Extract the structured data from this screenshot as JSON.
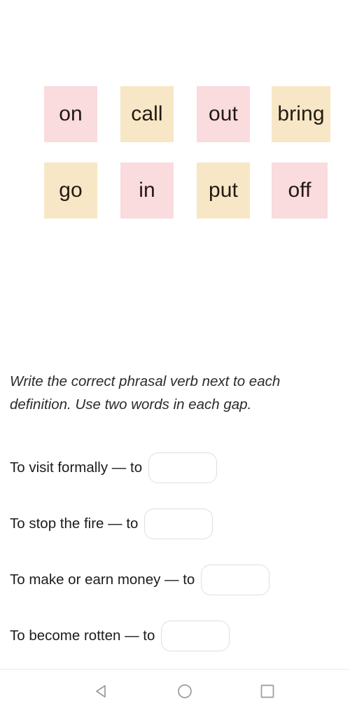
{
  "screen": {
    "background_color": "#ffffff",
    "text_color": "#1c1c1c"
  },
  "word_bank": {
    "tile_colors": {
      "pink": "#fadbde",
      "cream": "#f7e7c6"
    },
    "rows": [
      [
        {
          "label": "on",
          "color": "pink"
        },
        {
          "label": "call",
          "color": "cream"
        },
        {
          "label": "out",
          "color": "pink"
        },
        {
          "label": "bring",
          "color": "cream"
        }
      ],
      [
        {
          "label": "go",
          "color": "cream"
        },
        {
          "label": "in",
          "color": "pink"
        },
        {
          "label": "put",
          "color": "cream"
        },
        {
          "label": "off",
          "color": "pink"
        }
      ]
    ]
  },
  "instruction": {
    "line1": "Write the correct phrasal verb next to each",
    "line2": "definition. Use two words in each gap."
  },
  "questions": [
    {
      "prompt": "To visit formally — to",
      "value": "",
      "placeholder": ""
    },
    {
      "prompt": "To stop the fire — to",
      "value": "",
      "placeholder": ""
    },
    {
      "prompt": "To make or earn money — to",
      "value": "",
      "placeholder": ""
    },
    {
      "prompt": "To become rotten — to",
      "value": "",
      "placeholder": ""
    }
  ],
  "navbar": {
    "icon_color": "#9a9a9a",
    "back_label": "Back",
    "home_label": "Home",
    "recents_label": "Recents"
  }
}
